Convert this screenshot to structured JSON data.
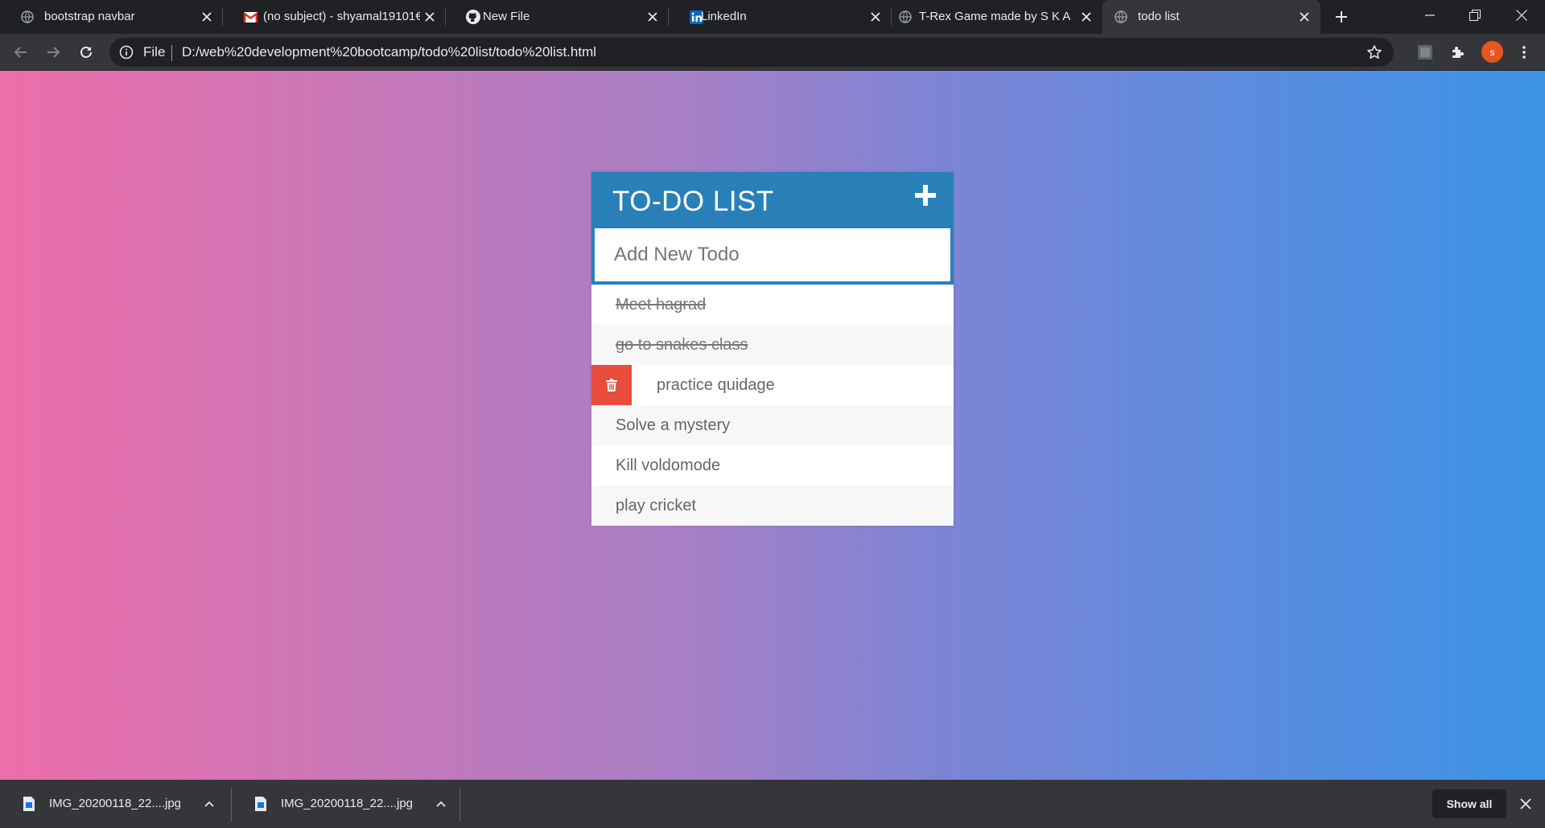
{
  "browser": {
    "tabs": [
      {
        "title": "bootstrap navbar",
        "icon": "globe-icon"
      },
      {
        "title": "(no subject) - shyamal19101€",
        "icon": "gmail-icon"
      },
      {
        "title": "New File",
        "icon": "github-icon"
      },
      {
        "title": "LinkedIn",
        "icon": "linkedin-icon"
      },
      {
        "title": "T-Rex Game made by S K Ag",
        "icon": "globe-icon"
      },
      {
        "title": "todo list",
        "icon": "globe-icon",
        "active": true
      }
    ],
    "address": {
      "scheme_label": "File",
      "url": "D:/web%20development%20bootcamp/todo%20list/todo%20list.html"
    },
    "profile_initial": "s"
  },
  "todo": {
    "title": "TO-DO LIST",
    "input_placeholder": "Add New Todo",
    "items": [
      {
        "text": "Meet hagrad",
        "done": true
      },
      {
        "text": "go to snakes class",
        "done": true
      },
      {
        "text": "practice quidage",
        "done": false,
        "hovered": true
      },
      {
        "text": "Solve a mystery",
        "done": false
      },
      {
        "text": "Kill voldomode",
        "done": false
      },
      {
        "text": "play cricket",
        "done": false
      }
    ]
  },
  "downloads": {
    "items": [
      {
        "name": "IMG_20200118_22....jpg"
      },
      {
        "name": "IMG_20200118_22....jpg"
      }
    ],
    "show_all_label": "Show all"
  },
  "colors": {
    "gradient_left": "#ed6ea9",
    "gradient_right": "#3b93e6",
    "header_blue": "#2980b9",
    "delete_red": "#e74c3c"
  }
}
